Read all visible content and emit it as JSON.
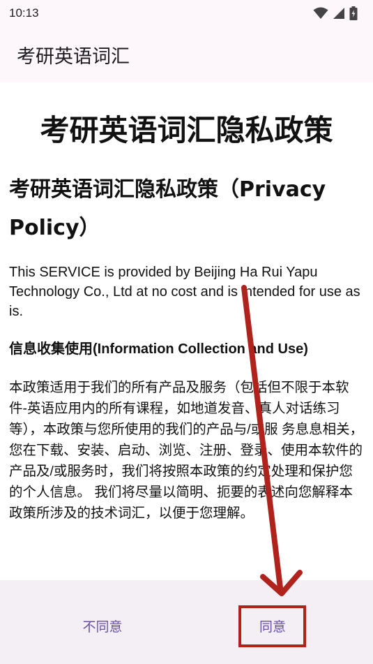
{
  "status_bar": {
    "time": "10:13",
    "icons": [
      "wifi-icon",
      "signal-icon",
      "battery-icon"
    ]
  },
  "app_bar": {
    "title": "考研英语词汇"
  },
  "content": {
    "heading": "考研英语词汇隐私政策",
    "section_title": "考研英语词汇隐私政策（Privacy Policy）",
    "intro": "This SERVICE is provided by Beijing Ha Rui Yapu Technology Co., Ltd at no cost and is intended for use as is.",
    "sub_title": "信息收集使用(Information Collection and Use)",
    "policy_text": "本政策适用于我们的所有产品及服务（包括但不限于本软件-英语应用内的所有课程，如地道发音、真人对话练习等），本政策与您所使用的我们的产品与/或服 务息息相关，您在下载、安装、启动、浏览、注册、登录、使用本软件的产品及/或服务时，我们将按照本政策的约定处理和保护您的个人信息。 我们将尽量以简明、扼要的表述向您解释本政策所涉及的技术词汇，以便于您理解。"
  },
  "bottom_bar": {
    "disagree_label": "不同意",
    "agree_label": "同意"
  },
  "colors": {
    "accent": "#6750a4",
    "annotation": "#b0221c",
    "bar_background": "#fdf7fc",
    "bottom_background": "#f4eff4"
  }
}
